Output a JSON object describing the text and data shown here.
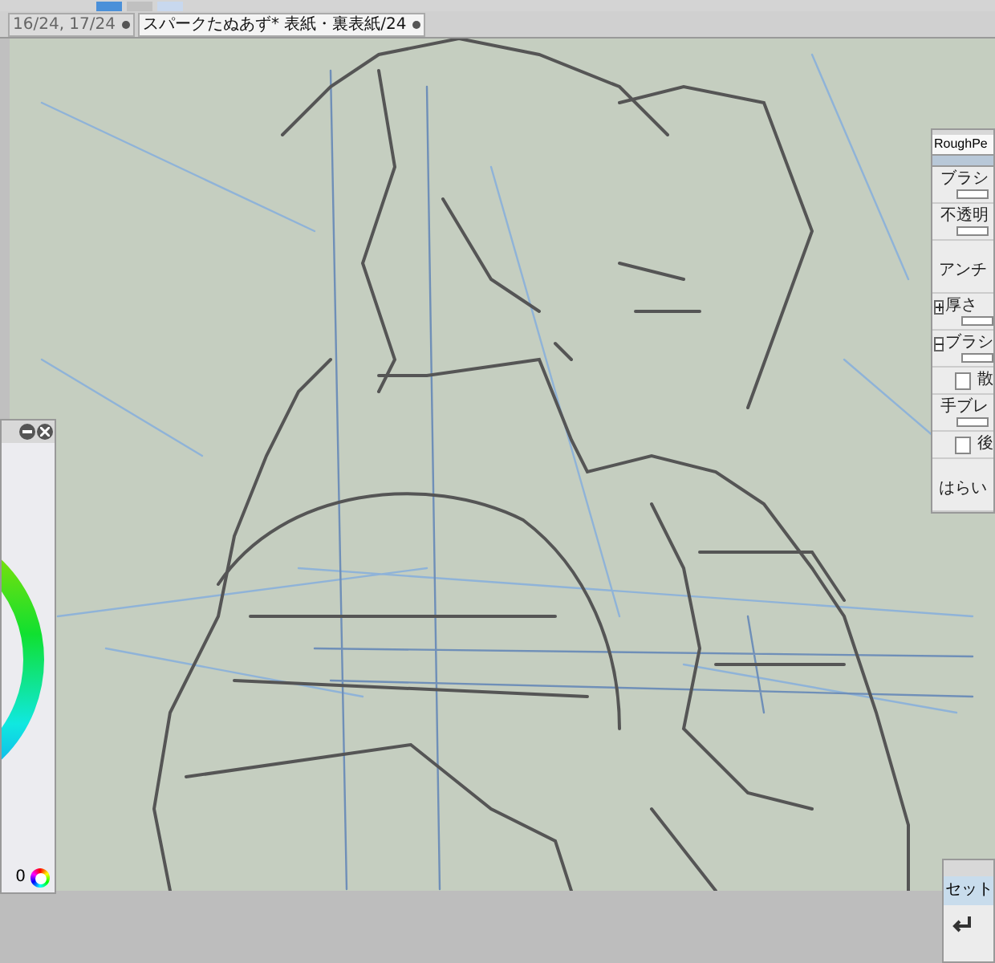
{
  "tabs": [
    {
      "label": "16/24, 17/24",
      "selected": false
    },
    {
      "label": "スパークたぬあず* 表紙・裏表紙/24",
      "selected": true
    }
  ],
  "brush_panel": {
    "tool_name": "RoughPe",
    "rows": [
      {
        "kind": "slider",
        "label": "ブラシ"
      },
      {
        "kind": "slider",
        "label": "不透明"
      },
      {
        "kind": "plain",
        "label": "アンチ"
      },
      {
        "kind": "expand",
        "label": "厚さ",
        "expanded": false
      },
      {
        "kind": "expand",
        "label": "ブラシ",
        "expanded": true
      },
      {
        "kind": "check",
        "label": "散",
        "checked": false
      },
      {
        "kind": "slider",
        "label": "手ブレ"
      },
      {
        "kind": "check",
        "label": "後",
        "checked": false
      },
      {
        "kind": "plain",
        "label": "はらい"
      }
    ]
  },
  "color_panel": {
    "value": "0"
  },
  "set_panel": {
    "tab": "セット"
  }
}
